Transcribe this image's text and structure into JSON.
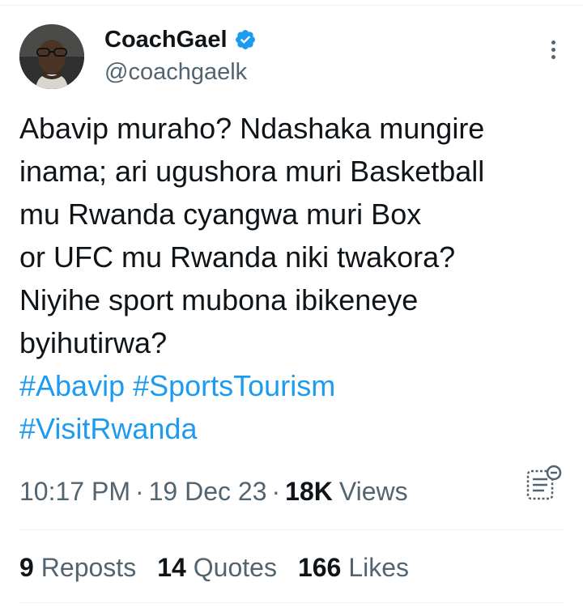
{
  "author": {
    "display_name": "CoachGael",
    "handle": "@coachgaelk",
    "verified": true
  },
  "tweet": {
    "lines": [
      "Abavip muraho? Ndashaka mungire",
      "inama; ari ugushora muri Basketball",
      "mu Rwanda cyangwa muri Box",
      "or UFC mu Rwanda niki twakora?",
      "Niyihe sport mubona ibikeneye",
      "byihutirwa?"
    ],
    "hashtag_line_1": "#Abavip #SportsTourism",
    "hashtag_line_2": "#VisitRwanda"
  },
  "meta": {
    "time": "10:17 PM",
    "separator": "·",
    "date": "19 Dec 23",
    "views_count": "18K",
    "views_label": "Views"
  },
  "stats": {
    "reposts_count": "9",
    "reposts_label": "Reposts",
    "quotes_count": "14",
    "quotes_label": "Quotes",
    "likes_count": "166",
    "likes_label": "Likes"
  },
  "icons": {
    "verified": "verified-badge-icon",
    "more": "more-vertical-icon",
    "analytics": "view-analytics-icon"
  },
  "colors": {
    "text": "#0f1419",
    "secondary": "#536471",
    "accent": "#1d9bf0",
    "divider": "#eff3f4"
  }
}
